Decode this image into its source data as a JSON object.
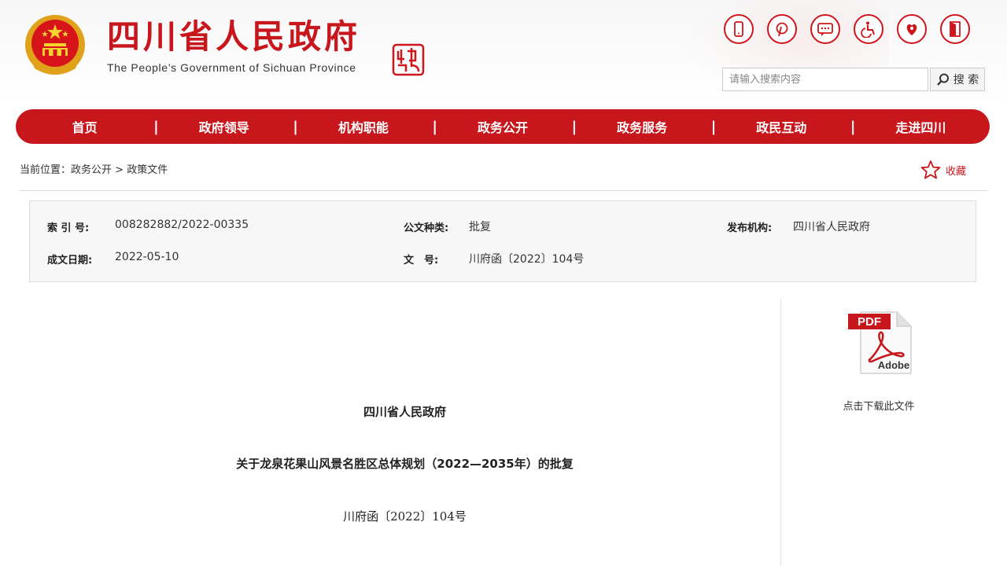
{
  "header": {
    "title": "四川省人民政府",
    "subtitle": "The People’s Government of Sichuan Province",
    "top_icons": [
      "mobile-icon",
      "pinterest-icon",
      "message-icon",
      "accessibility-icon",
      "elder-care-icon",
      "exit-icon"
    ],
    "search_placeholder": "请输入搜索内容",
    "search_label": "搜 索"
  },
  "nav": {
    "items": [
      "首页",
      "政府领导",
      "机构职能",
      "政务公开",
      "政务服务",
      "政民互动",
      "走进四川"
    ],
    "separator": "|"
  },
  "breadcrumb": {
    "prefix": "当前位置：",
    "items": [
      "政务公开",
      "政策文件"
    ],
    "separator": " > "
  },
  "favorite_label": "收藏",
  "meta": {
    "index_label": "索 引 号:",
    "index_value": "008282882/2022-00335",
    "type_label": "公文种类:",
    "type_value": "批复",
    "publisher_label": "发布机构:",
    "publisher_value": "四川省人民政府",
    "date_label": "成文日期:",
    "date_value": "2022-05-10",
    "docno_label": "文　号:",
    "docno_value": "川府函〔2022〕104号"
  },
  "download": {
    "pdf_label": "PDF",
    "adobe_label": "Adobe",
    "link_text": "点击下载此文件"
  },
  "document": {
    "issuer": "四川省人民政府",
    "title": "关于龙泉花果山风景名胜区总体规划（2022—2035年）的批复",
    "number": "川府函〔2022〕104号"
  },
  "colors": {
    "brand_red": "#c8161d",
    "meta_bg": "#f7f7f7"
  }
}
